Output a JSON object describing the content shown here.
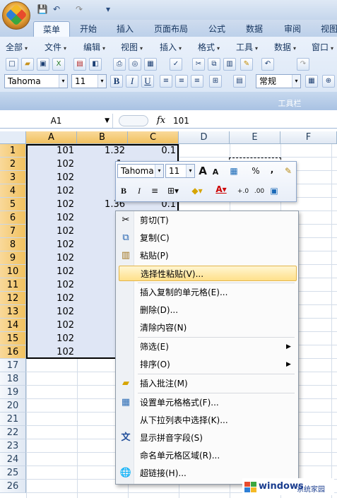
{
  "title_bar": {
    "qat_save": "💾",
    "qat_undo": "↶",
    "qat_redo": "↷",
    "qat_more": "▾"
  },
  "ribbon_tabs": [
    "菜单",
    "开始",
    "插入",
    "页面布局",
    "公式",
    "数据",
    "审阅",
    "视图"
  ],
  "classic_menu": [
    "全部",
    "文件",
    "编辑",
    "视图",
    "插入",
    "格式",
    "工具",
    "数据",
    "窗口"
  ],
  "font_name": "Tahoma",
  "font_size": "11",
  "format_buttons": [
    "B",
    "I",
    "U"
  ],
  "style_combo": "常规",
  "toolbar_label": "工具栏",
  "name_box": "A1",
  "fx_label": "fx",
  "formula_value": "101",
  "columns": [
    "A",
    "B",
    "C",
    "D",
    "E",
    "F"
  ],
  "rows": [
    "1",
    "2",
    "3",
    "4",
    "5",
    "6",
    "7",
    "8",
    "9",
    "10",
    "11",
    "12",
    "13",
    "14",
    "15",
    "16",
    "17",
    "18",
    "19",
    "20",
    "21",
    "22",
    "23",
    "24",
    "25",
    "26"
  ],
  "col_a": [
    "101",
    "102",
    "102",
    "102",
    "102",
    "102",
    "102",
    "102",
    "102",
    "102",
    "102",
    "102",
    "102",
    "102",
    "102",
    "102"
  ],
  "col_b": [
    "1.32",
    "1.",
    "1.",
    "1.",
    "1.36",
    "1.",
    "1.",
    "1.",
    "1",
    "1.",
    "1.",
    "1.",
    "1.",
    "1.",
    "1.",
    "1."
  ],
  "col_c": [
    "0.1",
    "",
    "",
    "",
    "0.1"
  ],
  "mini_toolbar": {
    "font": "Tahoma",
    "size": "11",
    "grow": "A",
    "shrink": "A",
    "percent": "%",
    "comma": ",",
    "bold": "B",
    "italic": "I",
    "center": "≡",
    "dec_inc": "+.0",
    "dec_dec": ".00"
  },
  "context_menu": {
    "items": [
      {
        "label": "剪切(T)",
        "icon": "scissors-icon"
      },
      {
        "label": "复制(C)",
        "icon": "copy-icon"
      },
      {
        "label": "粘贴(P)",
        "icon": "paste-icon"
      },
      {
        "label": "选择性粘贴(V)...",
        "highlighted": true
      },
      {
        "label": "插入复制的单元格(E)..."
      },
      {
        "label": "删除(D)..."
      },
      {
        "label": "清除内容(N)"
      },
      {
        "label": "筛选(E)",
        "submenu": true
      },
      {
        "label": "排序(O)",
        "submenu": true
      },
      {
        "label": "插入批注(M)",
        "icon": "comment-icon"
      },
      {
        "label": "设置单元格格式(F)...",
        "icon": "format-cells-icon"
      },
      {
        "label": "从下拉列表中选择(K)..."
      },
      {
        "label": "显示拼音字段(S)",
        "icon": "phonetic-icon"
      },
      {
        "label": "命名单元格区域(R)..."
      },
      {
        "label": "超链接(H)...",
        "icon": "hyperlink-icon"
      }
    ]
  },
  "watermark": {
    "brand": "windows",
    "site": "系统家园"
  }
}
